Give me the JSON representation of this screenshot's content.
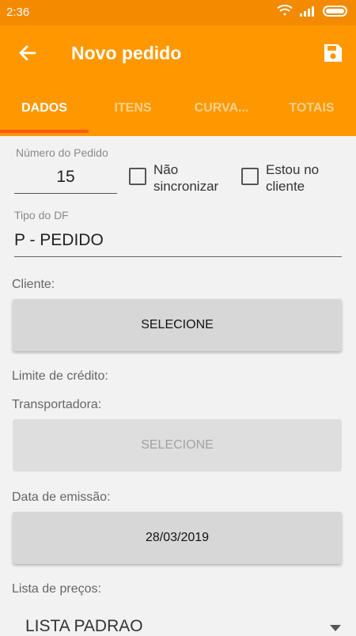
{
  "status": {
    "time": "2:36"
  },
  "app_bar": {
    "title": "Novo pedido"
  },
  "tabs": [
    {
      "label": "DADOS"
    },
    {
      "label": "ITENS"
    },
    {
      "label": "CURVA..."
    },
    {
      "label": "TOTAIS"
    }
  ],
  "form": {
    "numero_label": "Número do Pedido",
    "numero_value": "15",
    "nao_sincronizar_line1": "Não",
    "nao_sincronizar_line2": "sincronizar",
    "estou_no_cliente_line1": "Estou no",
    "estou_no_cliente_line2": "cliente",
    "tipo_df_label": "Tipo do DF",
    "tipo_df_value": "P - PEDIDO",
    "cliente_label": "Cliente:",
    "cliente_button": "SELECIONE",
    "limite_label": "Limite de crédito:",
    "transportadora_label": "Transportadora:",
    "transportadora_button": "SELECIONE",
    "data_label": "Data de emissão:",
    "data_button": "28/03/2019",
    "lista_label": "Lista de preços:",
    "lista_value": "LISTA PADRAO"
  },
  "colors": {
    "primary": "#ff9800",
    "status_bar": "#f38a00",
    "indicator": "#ff5a1c"
  }
}
